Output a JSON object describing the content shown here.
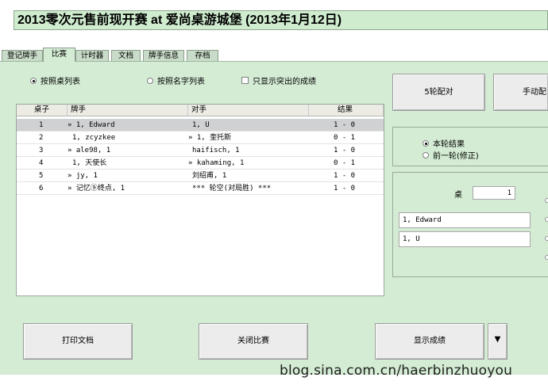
{
  "window": {
    "title": "2013零次元售前现开赛 at 爱尚桌游城堡 (2013年1月12日)"
  },
  "tabs": [
    {
      "label": "登记牌手"
    },
    {
      "label": "比赛"
    },
    {
      "label": "计时器"
    },
    {
      "label": "文档"
    },
    {
      "label": "牌手信息"
    },
    {
      "label": "存档"
    }
  ],
  "options": {
    "sort_by_table": "按照桌列表",
    "sort_by_name": "按照名字列表",
    "show_highlight": "只显示突出的成绩"
  },
  "pairings": {
    "headers": {
      "table": "桌子",
      "player": "牌手",
      "opponent": "对手",
      "result": "结果"
    },
    "rows": [
      {
        "table": "1",
        "player": "» 1, Edward",
        "opponent": "1, U",
        "result": "1 - 0"
      },
      {
        "table": "2",
        "player": "1, zcyzkee",
        "opponent": "» 1, 奎托斯",
        "result": "0 - 1"
      },
      {
        "table": "3",
        "player": "» ale98, 1",
        "opponent": "haifisch, 1",
        "result": "1 - 0"
      },
      {
        "table": "4",
        "player": "1, 天使长",
        "opponent": "» kahaming, 1",
        "result": "0 - 1"
      },
      {
        "table": "5",
        "player": "» jy, 1",
        "opponent": "刘绍甫, 1",
        "result": "1 - 0"
      },
      {
        "table": "6",
        "player": "» 记忆⑨终点, 1",
        "opponent": "*** 轮空(对局胜) ***",
        "result": "1 - 0"
      }
    ]
  },
  "side": {
    "pair_round_button": "5轮配对",
    "manual_pair_button": "手动配",
    "current_round": "本轮结果",
    "previous_round": "前一轮(修正)",
    "table_label": "桌",
    "table_value": "1",
    "player_a": "1, Edward",
    "player_b": "1, U"
  },
  "bottom": {
    "print_button": "打印文档",
    "close_button": "关闭比赛",
    "show_results_button": "显示成绩",
    "dropdown_arrow": "▼"
  },
  "watermark": "blog.sina.com.cn/haerbinzhuoyou"
}
